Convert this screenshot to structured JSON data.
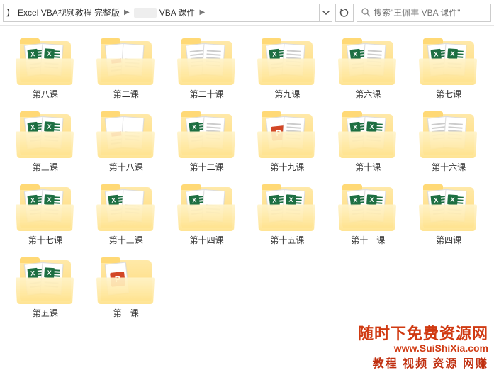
{
  "toolbar": {
    "breadcrumb": {
      "prefix": "】",
      "part1": "Excel VBA视频教程 完整版",
      "part2_suffix": "VBA 课件"
    },
    "search_placeholder": "搜索\"王佩丰 VBA 课件\""
  },
  "folders": [
    {
      "label": "第八课",
      "icons": [
        "excel",
        "excel"
      ]
    },
    {
      "label": "第二课",
      "icons": [
        "red",
        "plain"
      ]
    },
    {
      "label": "第二十课",
      "icons": [
        "lines",
        "lines"
      ]
    },
    {
      "label": "第九课",
      "icons": [
        "excel",
        "lines"
      ]
    },
    {
      "label": "第六课",
      "icons": [
        "excel",
        "lines"
      ]
    },
    {
      "label": "第七课",
      "icons": [
        "excel",
        "excel"
      ]
    },
    {
      "label": "第三课",
      "icons": [
        "excel",
        "excel"
      ]
    },
    {
      "label": "第十八课",
      "icons": [
        "red",
        "plain"
      ]
    },
    {
      "label": "第十二课",
      "icons": [
        "excel",
        "lines"
      ]
    },
    {
      "label": "第十九课",
      "icons": [
        "ppt",
        "lines"
      ]
    },
    {
      "label": "第十课",
      "icons": [
        "excel",
        "excel"
      ]
    },
    {
      "label": "第十六课",
      "icons": [
        "lines",
        "lines"
      ]
    },
    {
      "label": "第十七课",
      "icons": [
        "excel",
        "excel"
      ]
    },
    {
      "label": "第十三课",
      "icons": [
        "excel",
        "plain"
      ]
    },
    {
      "label": "第十四课",
      "icons": [
        "excel",
        "plain"
      ]
    },
    {
      "label": "第十五课",
      "icons": [
        "excel",
        "excel"
      ]
    },
    {
      "label": "第十一课",
      "icons": [
        "excel",
        "excel"
      ]
    },
    {
      "label": "第四课",
      "icons": [
        "excel",
        "excel"
      ]
    },
    {
      "label": "第五课",
      "icons": [
        "excel",
        "excel"
      ]
    },
    {
      "label": "第一课",
      "icons": [
        "ppt"
      ]
    }
  ],
  "watermark": {
    "title": "随时下免费资源网",
    "url": "www.SuiShiXia.com",
    "subtitle": "教程 视频 资源 网赚"
  }
}
